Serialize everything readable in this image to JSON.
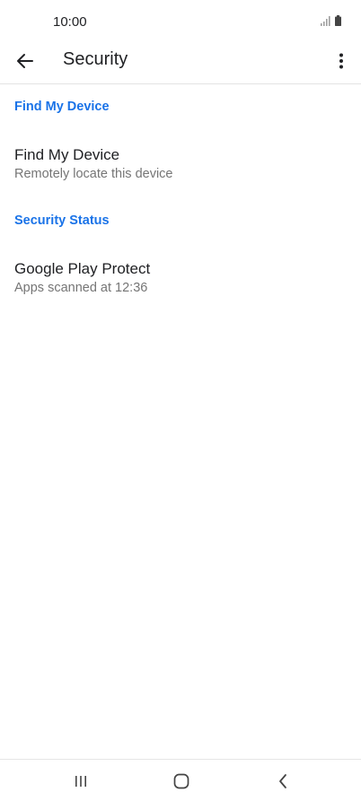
{
  "status_bar": {
    "time": "10:00",
    "icons": [
      "signal-icon",
      "battery-icon"
    ]
  },
  "app_bar": {
    "title": "Security",
    "back_icon": "arrow-left-icon",
    "more_icon": "more-vertical-icon"
  },
  "sections": [
    {
      "header": "Find My Device",
      "items": [
        {
          "title": "Find My Device",
          "summary": "Remotely locate this device"
        }
      ]
    },
    {
      "header": "Security Status",
      "items": [
        {
          "title": "Google Play Protect",
          "summary": "Apps scanned at 12:36"
        }
      ]
    }
  ],
  "nav_bar": {
    "icons": [
      "recents-icon",
      "home-icon",
      "back-icon"
    ]
  },
  "colors": {
    "accent": "#1a73e8",
    "text_primary": "#202124",
    "text_secondary": "#757575",
    "divider": "#e3e3e3"
  }
}
